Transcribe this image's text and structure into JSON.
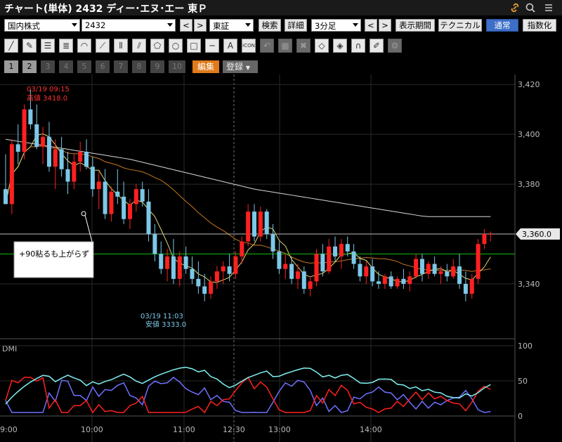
{
  "window": {
    "title": "チャート(単体) 2432 ディー･エヌ･エー 東Ｐ"
  },
  "header_icons": [
    "link-icon",
    "search-icon",
    "menu-icon"
  ],
  "toolbar": {
    "market_type": "国内株式",
    "code": "2432",
    "prev_label": "<",
    "next_label": ">",
    "exchange": "東証",
    "search_label": "検索",
    "detail_label": "詳細",
    "interval": "3分足",
    "period_label": "表示期間",
    "technical_label": "テクニカル",
    "normal_label": "通常",
    "index_label": "指数化"
  },
  "draw_tools": [
    {
      "icon": "line-icon",
      "enabled": true
    },
    {
      "icon": "pen-icon",
      "enabled": true
    },
    {
      "icon": "hlines-icon",
      "enabled": true
    },
    {
      "icon": "multi-hlines-icon",
      "enabled": true
    },
    {
      "icon": "arc-icon",
      "enabled": true
    },
    {
      "icon": "fan-icon",
      "enabled": true
    },
    {
      "icon": "vlines-icon",
      "enabled": true
    },
    {
      "icon": "parallel-icon",
      "enabled": true
    },
    {
      "icon": "pentagon-icon",
      "enabled": true
    },
    {
      "icon": "circle-icon",
      "enabled": true
    },
    {
      "icon": "rectangle-icon",
      "enabled": true
    },
    {
      "icon": "hline-icon",
      "enabled": true
    },
    {
      "icon": "text-icon",
      "enabled": true
    },
    {
      "icon": "icon-stamp-icon",
      "enabled": true
    },
    {
      "icon": "undo-icon",
      "enabled": false
    },
    {
      "icon": "table-icon",
      "enabled": false
    },
    {
      "icon": "delete-icon",
      "enabled": false
    },
    {
      "icon": "eraser-icon",
      "enabled": true
    },
    {
      "icon": "eraser-all-icon",
      "enabled": true
    },
    {
      "icon": "magnet-icon",
      "enabled": true
    },
    {
      "icon": "pen-edit-icon",
      "enabled": true
    },
    {
      "icon": "settings-icon",
      "enabled": false
    }
  ],
  "draw_glyphs": {
    "line-icon": "╱",
    "pen-icon": "✎",
    "hlines-icon": "☰",
    "multi-hlines-icon": "≣",
    "arc-icon": "◠",
    "fan-icon": "⟋",
    "vlines-icon": "⦀",
    "parallel-icon": "⫽",
    "pentagon-icon": "⬠",
    "circle-icon": "○",
    "rectangle-icon": "□",
    "hline-icon": "─",
    "text-icon": "A",
    "icon-stamp-icon": "☻",
    "undo-icon": "↶",
    "table-icon": "▦",
    "delete-icon": "✖",
    "eraser-icon": "◇",
    "eraser-all-icon": "◈",
    "magnet-icon": "∩",
    "pen-edit-icon": "✐",
    "settings-icon": "⚙"
  },
  "draw_text": {
    "text-icon": "A",
    "icon-stamp-icon": "ICON"
  },
  "layout_tabs": [
    "1",
    "2",
    "3",
    "4",
    "5",
    "6",
    "7",
    "8",
    "9",
    "10"
  ],
  "active_tabs": [
    "1",
    "2"
  ],
  "edit_label": "編集",
  "register_label": "登録",
  "chart_data": {
    "type": "candlestick",
    "price_axis": {
      "ticks": [
        3420,
        3400,
        3380,
        3360,
        3340
      ],
      "range": [
        3318,
        3424
      ],
      "current_price_label": "3,360.0",
      "current_price": 3360
    },
    "time_axis": {
      "labels": [
        "9:00",
        "10:00",
        "11:00",
        "12:30",
        "13:00",
        "14:00"
      ]
    },
    "annotations": {
      "high": {
        "time": "03/19 09:15",
        "label": "高値 3418.0",
        "value": 3418.0
      },
      "low": {
        "time": "03/19 11:03",
        "label": "安値 3333.0",
        "value": 3333.0
      },
      "note": "+90粘るも上がらず"
    },
    "green_line": 3352,
    "colors": {
      "up": "#ff2020",
      "down": "#7cc8e8",
      "ma_long": "#d8d8d8",
      "ma_mid": "#c87820",
      "ma_short": "#e0d870",
      "green": "#10c010",
      "dmi_plus": "#ff2020",
      "dmi_minus": "#7070ff",
      "adx": "#80f0f0"
    },
    "candles": [
      [
        3378,
        3392,
        3372,
        3372
      ],
      [
        3372,
        3398,
        3368,
        3396
      ],
      [
        3396,
        3404,
        3388,
        3393
      ],
      [
        3393,
        3412,
        3390,
        3410
      ],
      [
        3410,
        3418,
        3402,
        3404
      ],
      [
        3404,
        3412,
        3394,
        3395
      ],
      [
        3395,
        3403,
        3388,
        3399
      ],
      [
        3399,
        3405,
        3385,
        3387
      ],
      [
        3387,
        3398,
        3378,
        3394
      ],
      [
        3394,
        3399,
        3383,
        3386
      ],
      [
        3386,
        3393,
        3376,
        3381
      ],
      [
        3381,
        3392,
        3378,
        3389
      ],
      [
        3389,
        3397,
        3385,
        3393
      ],
      [
        3393,
        3398,
        3386,
        3387
      ],
      [
        3387,
        3391,
        3375,
        3378
      ],
      [
        3378,
        3385,
        3370,
        3381
      ],
      [
        3381,
        3386,
        3366,
        3368
      ],
      [
        3368,
        3379,
        3365,
        3377
      ],
      [
        3377,
        3386,
        3372,
        3375
      ],
      [
        3375,
        3381,
        3364,
        3366
      ],
      [
        3366,
        3374,
        3362,
        3372
      ],
      [
        3372,
        3380,
        3369,
        3378
      ],
      [
        3378,
        3381,
        3371,
        3373
      ],
      [
        3373,
        3378,
        3357,
        3360
      ],
      [
        3360,
        3364,
        3349,
        3352
      ],
      [
        3352,
        3357,
        3344,
        3346
      ],
      [
        3346,
        3354,
        3341,
        3351
      ],
      [
        3351,
        3358,
        3340,
        3342
      ],
      [
        3342,
        3353,
        3339,
        3351
      ],
      [
        3351,
        3355,
        3344,
        3346
      ],
      [
        3346,
        3351,
        3340,
        3342
      ],
      [
        3342,
        3349,
        3336,
        3339
      ],
      [
        3339,
        3344,
        3333,
        3336
      ],
      [
        3336,
        3343,
        3334,
        3341
      ],
      [
        3341,
        3347,
        3338,
        3345
      ],
      [
        3345,
        3349,
        3340,
        3347
      ],
      [
        3347,
        3352,
        3341,
        3344
      ],
      [
        3344,
        3353,
        3342,
        3351
      ],
      [
        3351,
        3359,
        3348,
        3357
      ],
      [
        3357,
        3372,
        3355,
        3369
      ],
      [
        3369,
        3372,
        3357,
        3359
      ],
      [
        3359,
        3371,
        3357,
        3369
      ],
      [
        3369,
        3370,
        3358,
        3360
      ],
      [
        3360,
        3364,
        3350,
        3353
      ],
      [
        3353,
        3357,
        3344,
        3346
      ],
      [
        3346,
        3352,
        3342,
        3348
      ],
      [
        3348,
        3351,
        3340,
        3342
      ],
      [
        3342,
        3348,
        3338,
        3345
      ],
      [
        3345,
        3347,
        3336,
        3338
      ],
      [
        3338,
        3343,
        3335,
        3341
      ],
      [
        3341,
        3354,
        3339,
        3352
      ],
      [
        3352,
        3356,
        3343,
        3345
      ],
      [
        3345,
        3358,
        3344,
        3355
      ],
      [
        3355,
        3359,
        3349,
        3351
      ],
      [
        3351,
        3358,
        3346,
        3356
      ],
      [
        3356,
        3359,
        3351,
        3353
      ],
      [
        3353,
        3356,
        3346,
        3348
      ],
      [
        3348,
        3351,
        3341,
        3343
      ],
      [
        3343,
        3349,
        3340,
        3347
      ],
      [
        3347,
        3350,
        3339,
        3341
      ],
      [
        3341,
        3345,
        3338,
        3340
      ],
      [
        3340,
        3344,
        3338,
        3343
      ],
      [
        3343,
        3345,
        3338,
        3339
      ],
      [
        3339,
        3343,
        3338,
        3342
      ],
      [
        3342,
        3346,
        3338,
        3340
      ],
      [
        3340,
        3345,
        3337,
        3343
      ],
      [
        3343,
        3352,
        3342,
        3350
      ],
      [
        3350,
        3352,
        3341,
        3344
      ],
      [
        3344,
        3349,
        3342,
        3348
      ],
      [
        3348,
        3351,
        3343,
        3344
      ],
      [
        3344,
        3347,
        3340,
        3345
      ],
      [
        3345,
        3348,
        3341,
        3343
      ],
      [
        3343,
        3350,
        3342,
        3347
      ],
      [
        3347,
        3352,
        3338,
        3340
      ],
      [
        3340,
        3345,
        3333,
        3336
      ],
      [
        3336,
        3344,
        3334,
        3342
      ],
      [
        3342,
        3358,
        3340,
        3356
      ],
      [
        3356,
        3362,
        3354,
        3360
      ],
      [
        3360,
        3361,
        3357,
        3360
      ]
    ],
    "dmi": {
      "label": "DMI",
      "ticks": [
        100,
        50,
        0
      ],
      "range": [
        0,
        100
      ]
    }
  }
}
